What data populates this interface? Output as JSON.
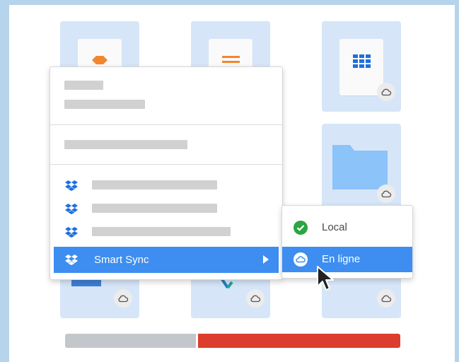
{
  "context_menu": {
    "smart_sync": {
      "label": "Smart Sync",
      "icon": "dropbox-icon"
    }
  },
  "submenu": {
    "options": [
      {
        "label": "Local",
        "icon": "check-circle-icon",
        "color": "#2ca542"
      },
      {
        "label": "En ligne",
        "icon": "cloud-circle-icon",
        "selected": true
      }
    ]
  },
  "colors": {
    "background": "#b6d4eb",
    "tile": "#d6e6f8",
    "accent": "#3d8ef0",
    "dropbox_blue": "#1f6fe0",
    "bar_gray": "#c3c7cc",
    "bar_red": "#db3e2d"
  },
  "storage_bar": {
    "used_fraction": 0.39,
    "over_fraction": 0.61
  }
}
